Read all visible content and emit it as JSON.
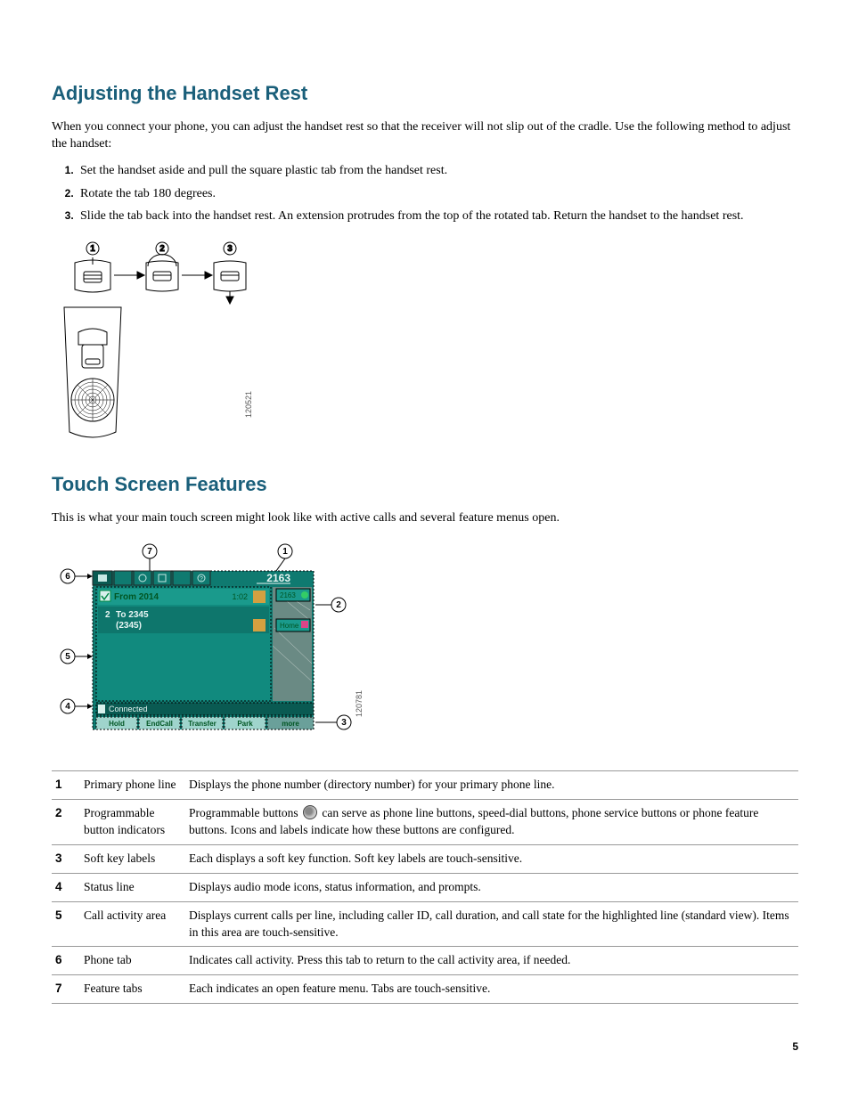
{
  "section1": {
    "heading": "Adjusting the Handset Rest",
    "intro": "When you connect your phone, you can adjust the handset rest so that the receiver will not slip out of the cradle. Use the following method to adjust the handset:",
    "steps": [
      "Set the handset aside and pull the square plastic tab from the handset rest.",
      "Rotate the tab 180 degrees.",
      "Slide the tab back into the handset rest. An extension protrudes from the top of the rotated tab. Return the handset to the handset rest."
    ],
    "figure_id": "120521"
  },
  "section2": {
    "heading": "Touch Screen Features",
    "intro": "This is what your main touch screen might look like with active calls and several feature menus open.",
    "figure_id": "120781",
    "screen": {
      "top_number": "2163",
      "call1_from": "From 2014",
      "call1_dur": "1:02",
      "call2_num": "2",
      "call2_to": "To 2345",
      "call2_sub": "(2345)",
      "side_label1": "2163",
      "side_label2": "Home",
      "status": "Connected",
      "softkeys": [
        "Hold",
        "EndCall",
        "Transfer",
        "Park",
        "more"
      ]
    },
    "table": [
      {
        "n": "1",
        "label": "Primary phone line",
        "desc": "Displays the phone number (directory number) for your primary phone line."
      },
      {
        "n": "2",
        "label": "Programmable button indicators",
        "desc_pre": "Programmable buttons ",
        "desc_post": " can serve as phone line buttons, speed-dial buttons, phone service buttons or phone feature buttons. Icons and labels indicate how these buttons are configured."
      },
      {
        "n": "3",
        "label": "Soft key labels",
        "desc": "Each displays a soft key function. Soft key labels are touch-sensitive."
      },
      {
        "n": "4",
        "label": "Status line",
        "desc": "Displays audio mode icons, status information, and prompts."
      },
      {
        "n": "5",
        "label": "Call activity area",
        "desc": "Displays current calls per line, including caller ID, call duration, and call state for the highlighted line (standard view). Items in this area are touch-sensitive."
      },
      {
        "n": "6",
        "label": "Phone tab",
        "desc": "Indicates call activity. Press this tab to return to the call activity area, if needed."
      },
      {
        "n": "7",
        "label": "Feature tabs",
        "desc": "Each indicates an open feature menu. Tabs are touch-sensitive."
      }
    ]
  },
  "page_number": "5"
}
